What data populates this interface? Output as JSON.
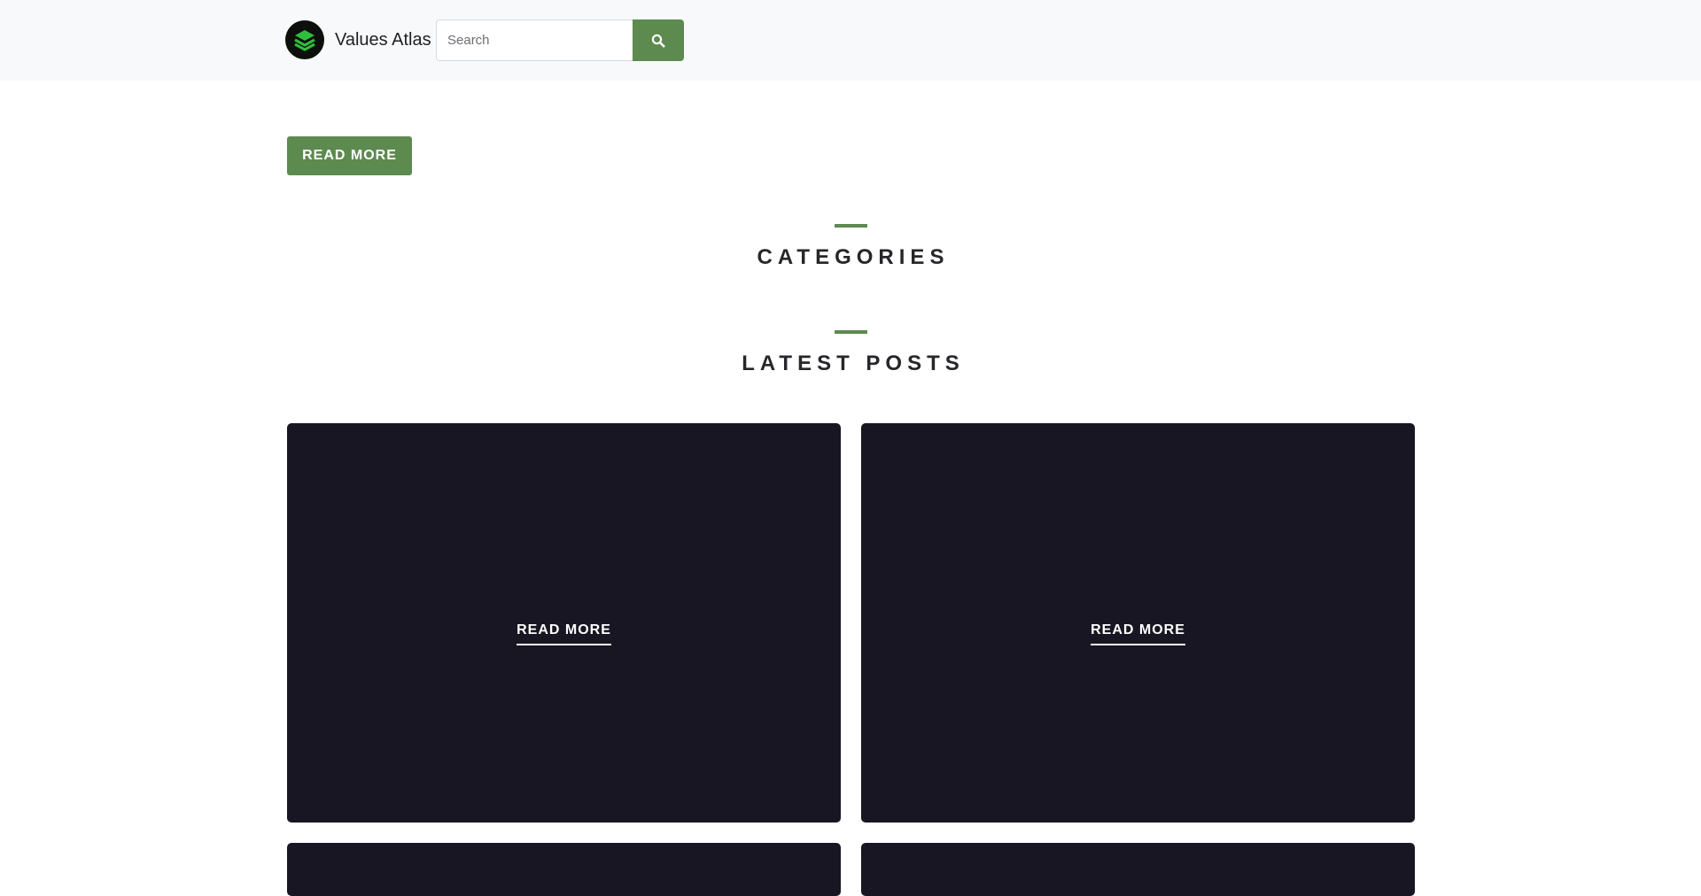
{
  "header": {
    "brand_name": "Values Atlas",
    "search": {
      "placeholder": "Search",
      "value": "",
      "button_icon": "search-icon"
    }
  },
  "hero": {
    "read_more_label": "READ MORE"
  },
  "sections": {
    "categories_title": "CATEGORIES",
    "latest_posts_title": "LATEST POSTS"
  },
  "posts": [
    {
      "read_more_label": "READ MORE"
    },
    {
      "read_more_label": "READ MORE"
    }
  ],
  "colors": {
    "accent": "#5c8a4f",
    "header_bg": "#f8f9fa",
    "card_bg": "#171622",
    "text_dark": "#26262b"
  }
}
